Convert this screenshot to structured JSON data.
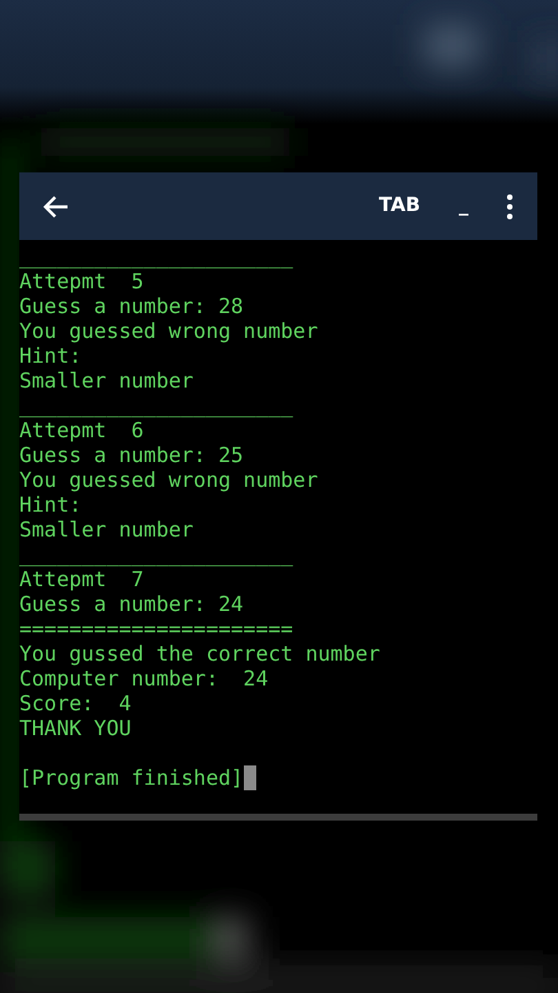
{
  "toolbar": {
    "keys": [
      "TAB",
      "_"
    ]
  },
  "terminal": {
    "lines": [
      "______________________",
      "Attepmt  5",
      "Guess a number: 28",
      "You guessed wrong number",
      "Hint:",
      "Smaller number",
      "______________________",
      "Attepmt  6",
      "Guess a number: 25",
      "You guessed wrong number",
      "Hint:",
      "Smaller number",
      "______________________",
      "Attepmt  7",
      "Guess a number: 24",
      "======================",
      "You gussed the correct number",
      "Computer number:  24",
      "Score:  4",
      "THANK YOU"
    ],
    "prompt": "[Program finished]"
  }
}
